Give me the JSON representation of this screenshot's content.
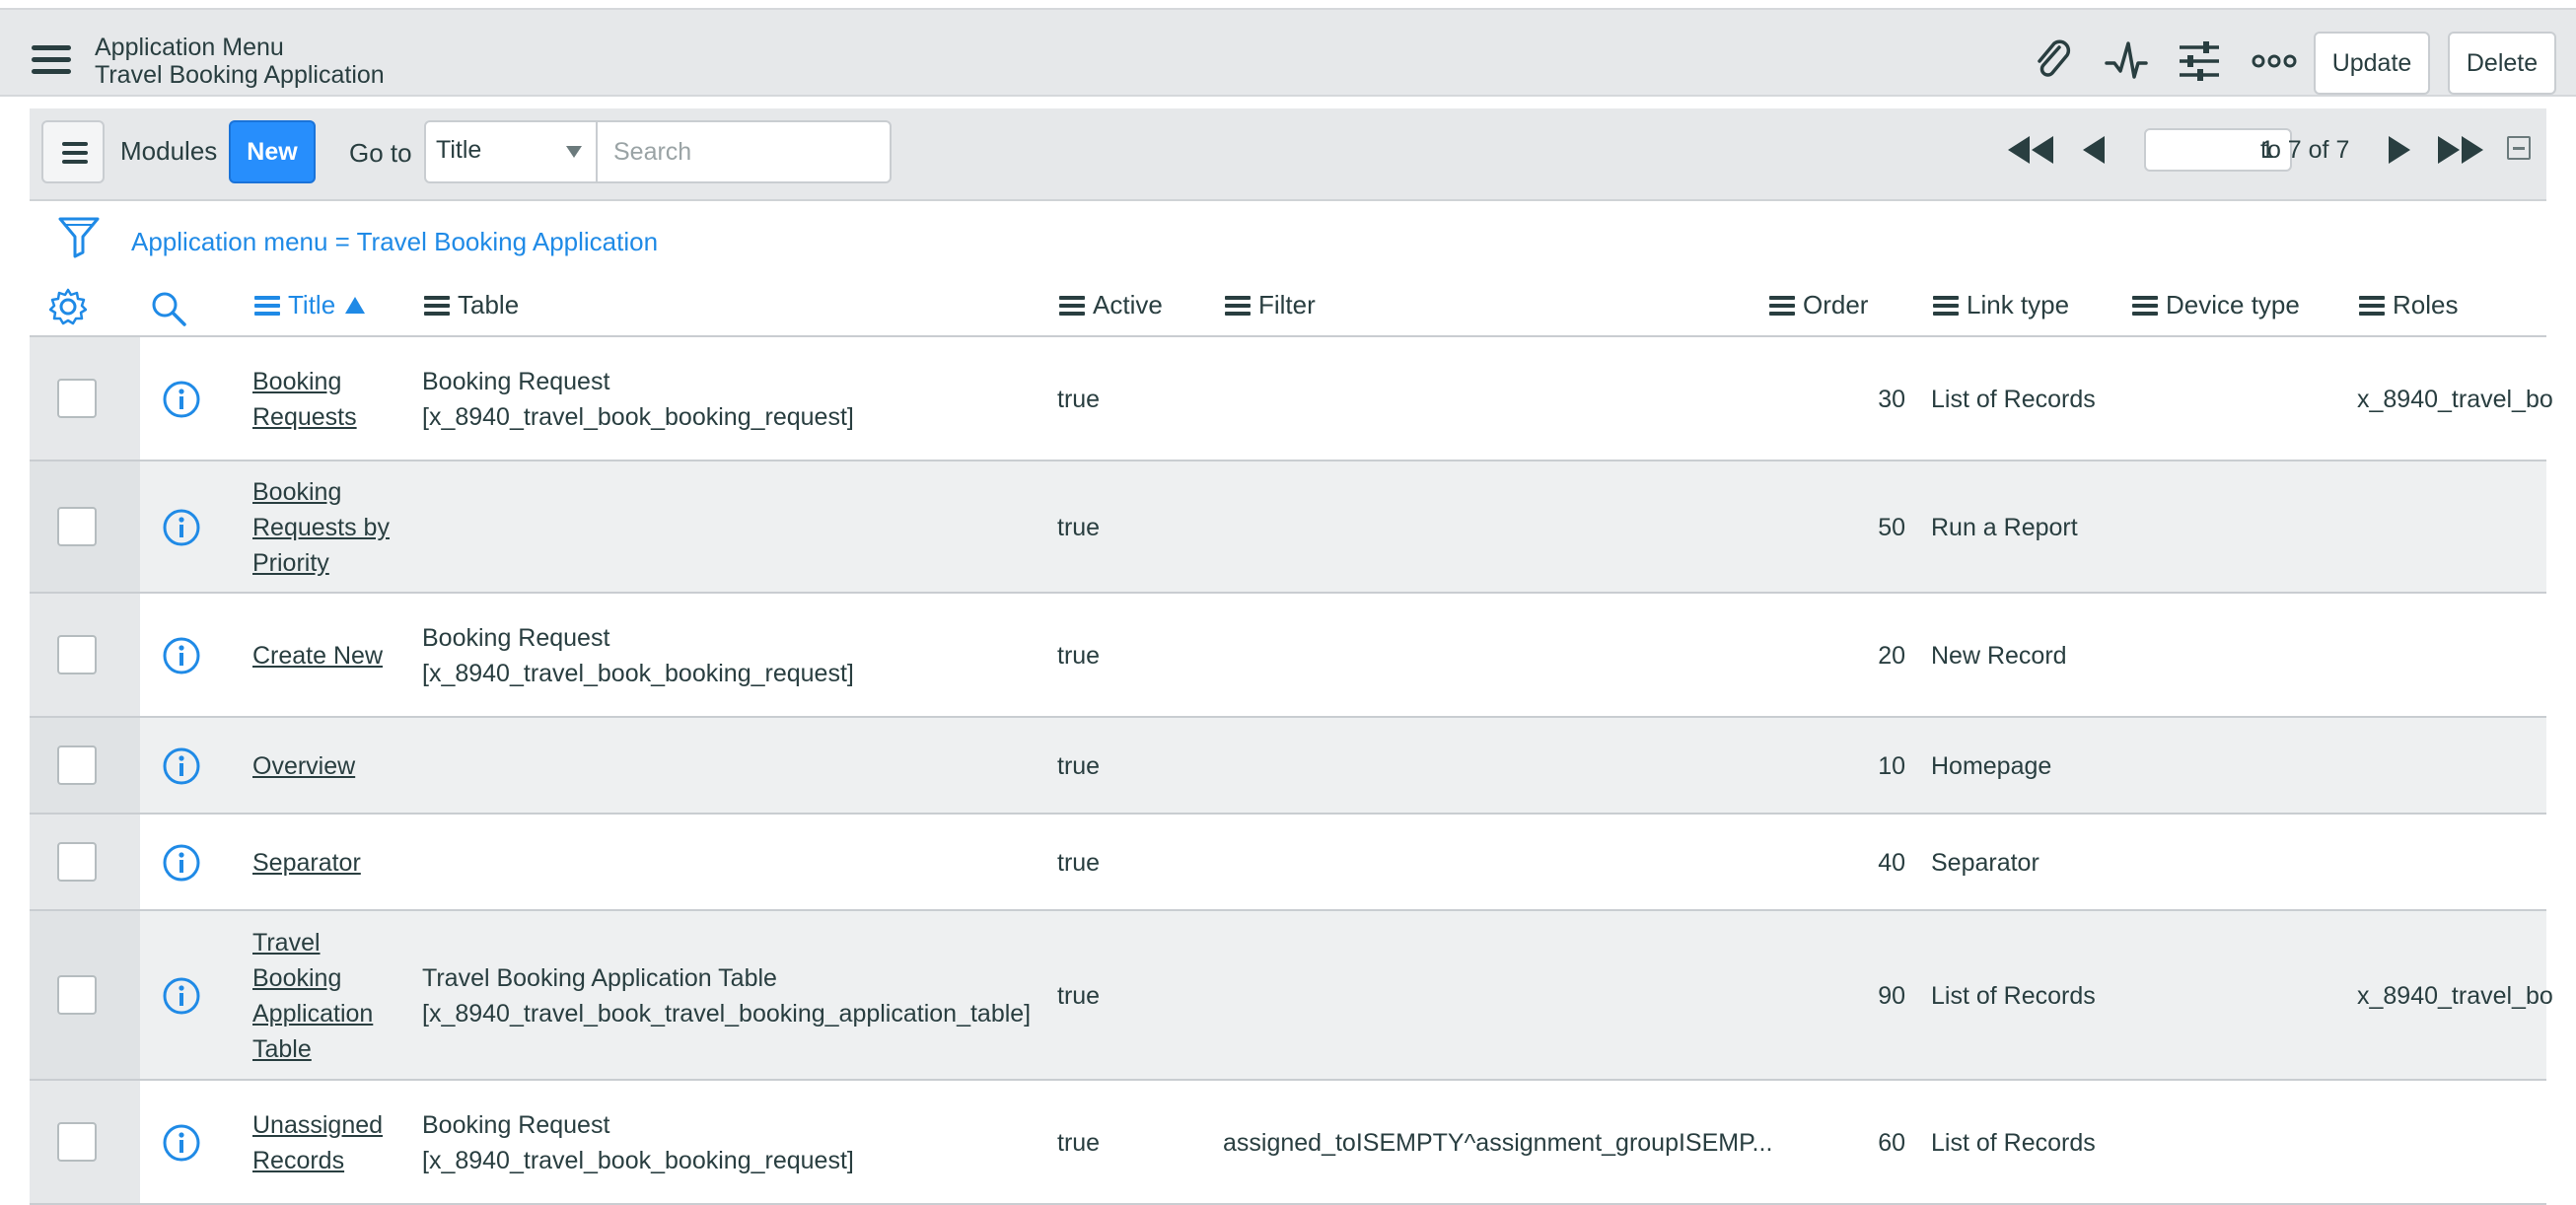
{
  "header": {
    "title": "Application Menu",
    "subtitle": "Travel Booking Application",
    "update_label": "Update",
    "delete_label": "Delete"
  },
  "toolbar": {
    "modules_label": "Modules",
    "new_label": "New",
    "goto_label": "Go to",
    "goto_field": "Title",
    "search_placeholder": "Search",
    "page_value": "1",
    "page_total": "to 7 of 7"
  },
  "filter": {
    "breadcrumb": "Application menu = Travel Booking Application"
  },
  "columns": {
    "title": "Title",
    "table": "Table",
    "active": "Active",
    "filter": "Filter",
    "order": "Order",
    "link_type": "Link type",
    "device_type": "Device type",
    "roles": "Roles"
  },
  "rows": [
    {
      "title_lines": [
        "Booking",
        "Requests"
      ],
      "table_lines": [
        "Booking Request",
        "[x_8940_travel_book_booking_request]"
      ],
      "active": "true",
      "filter": "",
      "order": "30",
      "link_type": "List of Records",
      "device_type": "",
      "roles": "x_8940_travel_bo"
    },
    {
      "title_lines": [
        "Booking",
        "Requests by",
        "Priority"
      ],
      "table_lines": [],
      "active": "true",
      "filter": "",
      "order": "50",
      "link_type": "Run a Report",
      "device_type": "",
      "roles": ""
    },
    {
      "title_lines": [
        "Create New"
      ],
      "table_lines": [
        "Booking Request",
        "[x_8940_travel_book_booking_request]"
      ],
      "active": "true",
      "filter": "",
      "order": "20",
      "link_type": "New Record",
      "device_type": "",
      "roles": ""
    },
    {
      "title_lines": [
        "Overview"
      ],
      "table_lines": [],
      "active": "true",
      "filter": "",
      "order": "10",
      "link_type": "Homepage",
      "device_type": "",
      "roles": ""
    },
    {
      "title_lines": [
        "Separator"
      ],
      "table_lines": [],
      "active": "true",
      "filter": "",
      "order": "40",
      "link_type": "Separator",
      "device_type": "",
      "roles": ""
    },
    {
      "title_lines": [
        "Travel",
        "Booking",
        "Application",
        "Table"
      ],
      "table_lines": [
        "Travel Booking Application Table",
        "[x_8940_travel_book_travel_booking_application_table]"
      ],
      "active": "true",
      "filter": "",
      "order": "90",
      "link_type": "List of Records",
      "device_type": "",
      "roles": "x_8940_travel_bo"
    },
    {
      "title_lines": [
        "Unassigned",
        "Records"
      ],
      "table_lines": [
        "Booking Request",
        "[x_8940_travel_book_booking_request]"
      ],
      "active": "true",
      "filter": "assigned_toISEMPTY^assignment_groupISEMP...",
      "order": "60",
      "link_type": "List of Records",
      "device_type": "",
      "roles": ""
    }
  ],
  "colors": {
    "accent": "#278efc",
    "link": "#1f8ae6",
    "header_bg": "#e6e8ea"
  }
}
